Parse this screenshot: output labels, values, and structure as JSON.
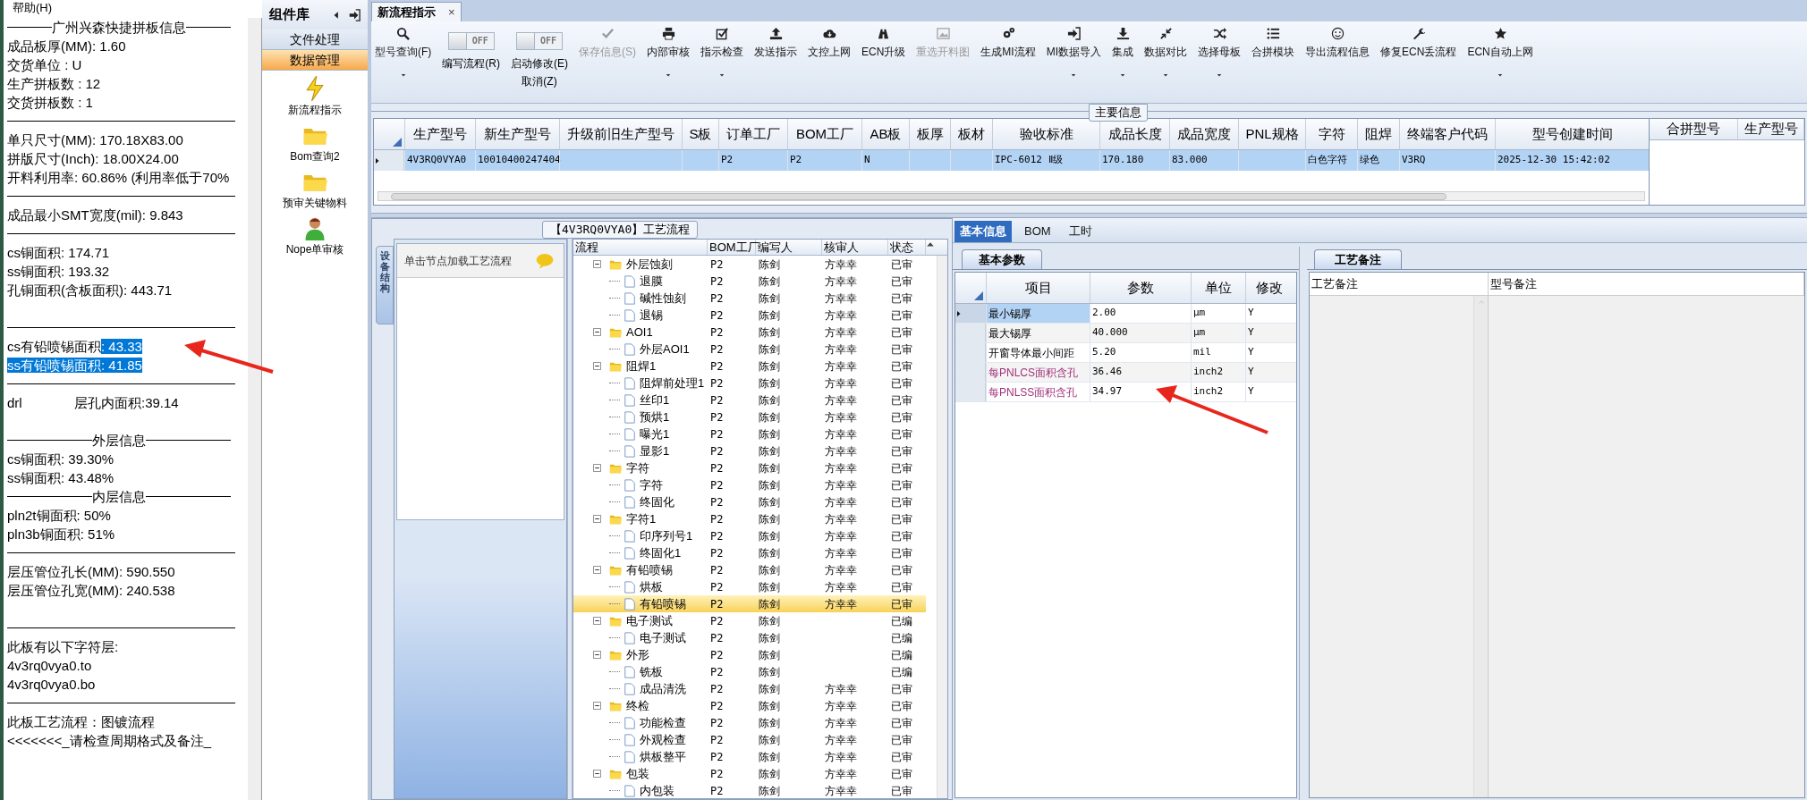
{
  "menu": {
    "label": "帮助(H)"
  },
  "info_panel": {
    "lines": [
      {
        "kind": "heading",
        "text": "广州兴森快捷拼板信息"
      },
      {
        "kind": "text",
        "text": "成品板厚(MM): 1.60"
      },
      {
        "kind": "text",
        "text": "交货单位 : U"
      },
      {
        "kind": "text",
        "text": "生产拼板数 : 12"
      },
      {
        "kind": "text",
        "text": "交货拼板数 : 1"
      },
      {
        "kind": "rule"
      },
      {
        "kind": "text",
        "text": "单只尺寸(MM): 170.18X83.00"
      },
      {
        "kind": "text",
        "text": "拼版尺寸(Inch): 18.00X24.00"
      },
      {
        "kind": "text",
        "text": "开料利用率: 60.86% (利用率低于70%"
      },
      {
        "kind": "rule"
      },
      {
        "kind": "text",
        "text": "成品最小SMT宽度(mil): 9.843"
      },
      {
        "kind": "rule"
      },
      {
        "kind": "text",
        "text": "cs铜面积: 174.71"
      },
      {
        "kind": "text",
        "text": "ss铜面积: 193.32"
      },
      {
        "kind": "text",
        "text": "孔铜面积(含板面积): 443.71"
      },
      {
        "kind": "blank"
      },
      {
        "kind": "rule"
      },
      {
        "kind": "parts",
        "parts": [
          {
            "text": "cs有铅喷锡面积",
            "selected": false
          },
          {
            "text": ": 43.33",
            "selected": true
          }
        ]
      },
      {
        "kind": "parts",
        "parts": [
          {
            "text": "ss有铅喷锡面积: 41.85",
            "selected": true
          }
        ]
      },
      {
        "kind": "rule"
      },
      {
        "kind": "pair",
        "text": "drl",
        "value": "层孔内面积:39.14"
      },
      {
        "kind": "blank"
      },
      {
        "kind": "heading",
        "text": "外层信息"
      },
      {
        "kind": "text",
        "text": "cs铜面积: 39.30%"
      },
      {
        "kind": "text",
        "text": "ss铜面积: 43.48%"
      },
      {
        "kind": "heading",
        "text": "内层信息"
      },
      {
        "kind": "text",
        "text": "pln2t铜面积: 50%"
      },
      {
        "kind": "text",
        "text": "pln3b铜面积: 51%"
      },
      {
        "kind": "rule"
      },
      {
        "kind": "text",
        "text": "层压管位孔长(MM): 590.550"
      },
      {
        "kind": "text",
        "text": "层压管位孔宽(MM): 240.538"
      },
      {
        "kind": "blank"
      },
      {
        "kind": "rule"
      },
      {
        "kind": "text",
        "text": "此板有以下字符层:"
      },
      {
        "kind": "text",
        "text": "4v3rq0vya0.to"
      },
      {
        "kind": "text",
        "text": "4v3rq0vya0.bo"
      },
      {
        "kind": "rule"
      },
      {
        "kind": "text",
        "text": "此板工艺流程：图镀流程"
      },
      {
        "kind": "text",
        "text": "<<<<<<<_请检查周期格式及备注_"
      }
    ]
  },
  "component_library": {
    "title": "组件库",
    "categories": [
      {
        "label": "文件处理",
        "selected": false
      },
      {
        "label": "数据管理",
        "selected": true
      }
    ],
    "items": [
      {
        "label": "新流程指示"
      },
      {
        "label": "Bom查询2"
      },
      {
        "label": "预审关键物料"
      },
      {
        "label": "Nope单审核"
      }
    ]
  },
  "document_tab": {
    "label": "新流程指示",
    "close": "×"
  },
  "toolbar": [
    {
      "kind": "button",
      "label": "型号查询(F)",
      "disabled": false,
      "dropdown": true
    },
    {
      "kind": "toggle",
      "label": "编写流程(R)",
      "toggle_text": "OFF",
      "on": false
    },
    {
      "kind": "toggle",
      "label": "启动修改(E)",
      "sublabel": "取消(Z)",
      "toggle_text": "OFF",
      "on": false
    },
    {
      "kind": "button",
      "label": "保存信息(S)",
      "disabled": true,
      "dropdown": false
    },
    {
      "kind": "button",
      "label": "内部审核",
      "disabled": false,
      "dropdown": true
    },
    {
      "kind": "button",
      "label": "指示检查",
      "disabled": false,
      "dropdown": true
    },
    {
      "kind": "button",
      "label": "发送指示",
      "disabled": false,
      "dropdown": false
    },
    {
      "kind": "button",
      "label": "文控上网",
      "disabled": false,
      "dropdown": false
    },
    {
      "kind": "button",
      "label": "ECN升级",
      "disabled": false,
      "dropdown": false
    },
    {
      "kind": "button",
      "label": "重选开料图",
      "disabled": true,
      "dropdown": false
    },
    {
      "kind": "button",
      "label": "生成MI流程",
      "disabled": false,
      "dropdown": false
    },
    {
      "kind": "button",
      "label": "MI数据导入",
      "disabled": false,
      "dropdown": true
    },
    {
      "kind": "button",
      "label": "集成",
      "disabled": false,
      "dropdown": true
    },
    {
      "kind": "button",
      "label": "数据对比",
      "disabled": false,
      "dropdown": true
    },
    {
      "kind": "button",
      "label": "选择母板",
      "disabled": false,
      "dropdown": true
    },
    {
      "kind": "button",
      "label": "合拼模块",
      "disabled": false,
      "dropdown": false
    },
    {
      "kind": "button",
      "label": "导出流程信息",
      "disabled": false,
      "dropdown": false
    },
    {
      "kind": "button",
      "label": "修复ECN丢流程",
      "disabled": false,
      "dropdown": false
    },
    {
      "kind": "button",
      "label": "ECN自动上网",
      "disabled": false,
      "dropdown": true
    }
  ],
  "main_info": {
    "title": "主要信息",
    "columns": [
      "生产型号",
      "新生产型号",
      "升级前旧生产型号",
      "S板",
      "订单工厂",
      "BOM工厂",
      "AB板",
      "板厚",
      "板材",
      "验收标准",
      "成品长度",
      "成品宽度",
      "PNL规格",
      "字符",
      "阻焊",
      "终端客户代码",
      "型号创建时间"
    ],
    "rows": [
      {
        "selected": true,
        "cells": [
          "4V3RQ0VYA0",
          "10010400247404",
          null,
          null,
          "P2",
          "P2",
          "N",
          null,
          null,
          "IPC-6012 Ⅱ级",
          "170.180",
          "83.000",
          null,
          "白色字符",
          "绿色",
          "V3RQ",
          "2025-12-30 15:42:02"
        ]
      }
    ],
    "side_columns": [
      "合拼型号",
      "生产型号"
    ]
  },
  "process_flow": {
    "title": "【4V3RQ0VYA0】工艺流程",
    "side_tab": "设备结构",
    "hint": "单击节点加载工艺流程",
    "columns": [
      "流程",
      "BOM工厂",
      "编写人",
      "核审人",
      "状态"
    ],
    "tree": [
      {
        "name": "外层蚀刻",
        "bom": "P2",
        "writer": "陈剑",
        "reviewer": "方幸幸",
        "status": "已审",
        "expanded": true,
        "selected": false,
        "children": [
          {
            "name": "退膜",
            "bom": "P2",
            "writer": "陈剑",
            "reviewer": "方幸幸",
            "status": "已审",
            "selected": false
          },
          {
            "name": "碱性蚀刻",
            "bom": "P2",
            "writer": "陈剑",
            "reviewer": "方幸幸",
            "status": "已审",
            "selected": false
          },
          {
            "name": "退锡",
            "bom": "P2",
            "writer": "陈剑",
            "reviewer": "方幸幸",
            "status": "已审",
            "selected": false
          }
        ]
      },
      {
        "name": "AOI1",
        "bom": "P2",
        "writer": "陈剑",
        "reviewer": "方幸幸",
        "status": "已审",
        "expanded": true,
        "selected": false,
        "children": [
          {
            "name": "外层AOI1",
            "bom": "P2",
            "writer": "陈剑",
            "reviewer": "方幸幸",
            "status": "已审",
            "selected": false
          }
        ]
      },
      {
        "name": "阻焊1",
        "bom": "P2",
        "writer": "陈剑",
        "reviewer": "方幸幸",
        "status": "已审",
        "expanded": true,
        "selected": false,
        "children": [
          {
            "name": "阻焊前处理1",
            "bom": "P2",
            "writer": "陈剑",
            "reviewer": "方幸幸",
            "status": "已审",
            "selected": false
          },
          {
            "name": "丝印1",
            "bom": "P2",
            "writer": "陈剑",
            "reviewer": "方幸幸",
            "status": "已审",
            "selected": false
          },
          {
            "name": "预烘1",
            "bom": "P2",
            "writer": "陈剑",
            "reviewer": "方幸幸",
            "status": "已审",
            "selected": false
          },
          {
            "name": "曝光1",
            "bom": "P2",
            "writer": "陈剑",
            "reviewer": "方幸幸",
            "status": "已审",
            "selected": false
          },
          {
            "name": "显影1",
            "bom": "P2",
            "writer": "陈剑",
            "reviewer": "方幸幸",
            "status": "已审",
            "selected": false
          }
        ]
      },
      {
        "name": "字符",
        "bom": "P2",
        "writer": "陈剑",
        "reviewer": "方幸幸",
        "status": "已审",
        "expanded": true,
        "selected": false,
        "children": [
          {
            "name": "字符",
            "bom": "P2",
            "writer": "陈剑",
            "reviewer": "方幸幸",
            "status": "已审",
            "selected": false
          },
          {
            "name": "终固化",
            "bom": "P2",
            "writer": "陈剑",
            "reviewer": "方幸幸",
            "status": "已审",
            "selected": false
          }
        ]
      },
      {
        "name": "字符1",
        "bom": "P2",
        "writer": "陈剑",
        "reviewer": "方幸幸",
        "status": "已审",
        "expanded": true,
        "selected": false,
        "children": [
          {
            "name": "印序列号1",
            "bom": "P2",
            "writer": "陈剑",
            "reviewer": "方幸幸",
            "status": "已审",
            "selected": false
          },
          {
            "name": "终固化1",
            "bom": "P2",
            "writer": "陈剑",
            "reviewer": "方幸幸",
            "status": "已审",
            "selected": false
          }
        ]
      },
      {
        "name": "有铅喷锡",
        "bom": "P2",
        "writer": "陈剑",
        "reviewer": "方幸幸",
        "status": "已审",
        "expanded": true,
        "selected": false,
        "children": [
          {
            "name": "烘板",
            "bom": "P2",
            "writer": "陈剑",
            "reviewer": "方幸幸",
            "status": "已审",
            "selected": false
          },
          {
            "name": "有铅喷锡",
            "bom": "P2",
            "writer": "陈剑",
            "reviewer": "方幸幸",
            "status": "已审",
            "selected": true
          }
        ]
      },
      {
        "name": "电子测试",
        "bom": "P2",
        "writer": "陈剑",
        "status": "已编",
        "expanded": true,
        "selected": false,
        "children": [
          {
            "name": "电子测试",
            "bom": "P2",
            "writer": "陈剑",
            "status": "已编",
            "selected": false
          }
        ]
      },
      {
        "name": "外形",
        "bom": "P2",
        "writer": "陈剑",
        "status": "已编",
        "expanded": true,
        "selected": false,
        "children": [
          {
            "name": "铣板",
            "bom": "P2",
            "writer": "陈剑",
            "status": "已编",
            "selected": false
          },
          {
            "name": "成品清洗",
            "bom": "P2",
            "writer": "陈剑",
            "reviewer": "方幸幸",
            "status": "已审",
            "selected": false
          }
        ]
      },
      {
        "name": "终检",
        "bom": "P2",
        "writer": "陈剑",
        "reviewer": "方幸幸",
        "status": "已审",
        "expanded": true,
        "selected": false,
        "children": [
          {
            "name": "功能检查",
            "bom": "P2",
            "writer": "陈剑",
            "reviewer": "方幸幸",
            "status": "已审",
            "selected": false
          },
          {
            "name": "外观检查",
            "bom": "P2",
            "writer": "陈剑",
            "reviewer": "方幸幸",
            "status": "已审",
            "selected": false
          },
          {
            "name": "烘板整平",
            "bom": "P2",
            "writer": "陈剑",
            "reviewer": "方幸幸",
            "status": "已审",
            "selected": false
          }
        ]
      },
      {
        "name": "包装",
        "bom": "P2",
        "writer": "陈剑",
        "reviewer": "方幸幸",
        "status": "已审",
        "expanded": true,
        "selected": false,
        "children": [
          {
            "name": "内包装",
            "bom": "P2",
            "writer": "陈剑",
            "reviewer": "方幸幸",
            "status": "已审",
            "selected": false
          }
        ]
      }
    ]
  },
  "detail_tabs": [
    {
      "label": "基本信息",
      "selected": true
    },
    {
      "label": "BOM",
      "selected": false
    },
    {
      "label": "工时",
      "selected": false
    }
  ],
  "basic_params": {
    "tab": "基本参数",
    "columns": [
      "项目",
      "参数",
      "单位",
      "修改"
    ],
    "rows": [
      {
        "item": "最小锡厚",
        "value": "2.00",
        "unit": "μm",
        "modify": "Y",
        "highlighted": false,
        "selected": true
      },
      {
        "item": "最大锡厚",
        "value": "40.000",
        "unit": "μm",
        "modify": "Y",
        "highlighted": false,
        "selected": false
      },
      {
        "item": "开窗导体最小间距",
        "value": "5.20",
        "unit": "mil",
        "modify": "Y",
        "highlighted": false,
        "selected": false
      },
      {
        "item": "每PNLCS面积含孔",
        "value": "36.46",
        "unit": "inch2",
        "modify": "Y",
        "highlighted": true,
        "selected": false
      },
      {
        "item": "每PNLSS面积含孔",
        "value": "34.97",
        "unit": "inch2",
        "modify": "Y",
        "highlighted": true,
        "selected": false
      }
    ]
  },
  "process_notes": {
    "tab": "工艺备注",
    "columns": [
      "工艺备注",
      "型号备注"
    ]
  }
}
